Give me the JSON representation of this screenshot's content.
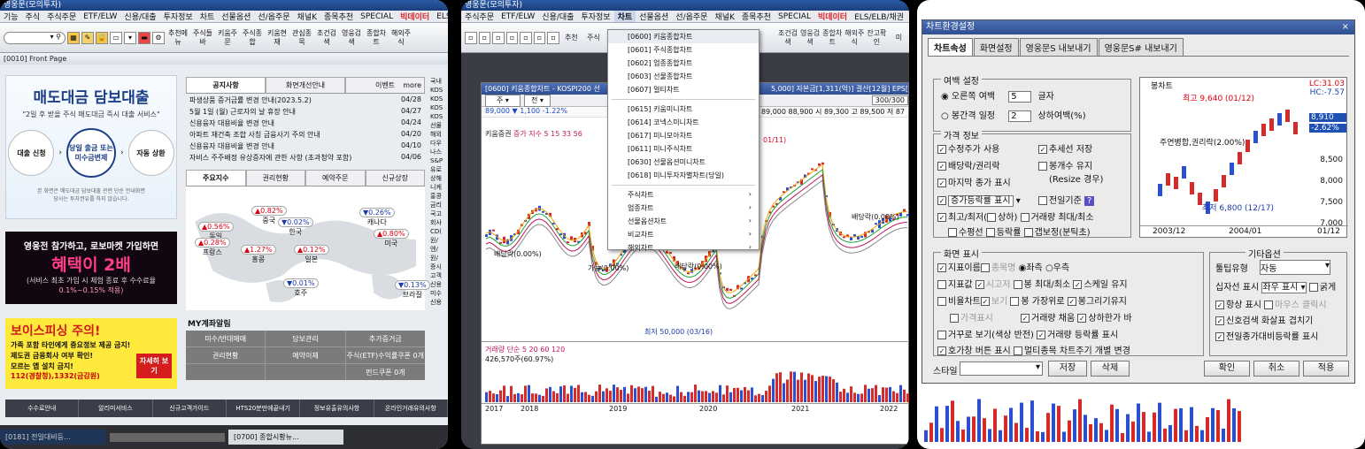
{
  "panel1": {
    "title": "영웅문(모의투자)",
    "menu": [
      "기능",
      "주식",
      "주식주문",
      "ETF/ELW",
      "신용/대출",
      "투자정보",
      "차트",
      "선물옵션",
      "선/옵주문",
      "채널K",
      "종목추천",
      "SPECIAL",
      "빅데이터",
      "ELS/DLS"
    ],
    "toolbar_buttons": [
      "추천메뉴",
      "주식들바",
      "키움주문",
      "주식종합",
      "키움현재",
      "관심종목",
      "조건검색",
      "영웅검색",
      "종합차트",
      "해외주식"
    ],
    "window_title": "[0010] Front Page",
    "promo": {
      "title": "매도대금 담보대출",
      "subtitle": "\"2일 후 받을 주식 매도대금 즉시 대출 서비스\"",
      "step1": "대출 신청",
      "step2": "당일 출금 또는 미수금변제",
      "step3": "자동 상환",
      "note1": "본 화면은 매도대금 담보대출 관련 단순 안내화면",
      "note2": "당사는 투자권유를 하지 않습니다."
    },
    "promo2": {
      "line1": "영웅전 참가하고, 로보마켓 가입하면",
      "line2": "혜택이 2배",
      "line3": "(서비스 최초 가입 시 체험 종료 후 수수료율",
      "line4": "0.1%~0.15% 적용)"
    },
    "phishing": {
      "title": "보이스피싱 주의!",
      "items": [
        "가족 포함 타인에게 중요정보 제공 금지!",
        "제도권 금융회사 여부 확인!",
        "모르는 앱 설치 금지!"
      ],
      "contact": "112(경찰청),1332(금감원)",
      "detail": "자세히 보기"
    },
    "notice_tabs": [
      "공지사항",
      "화면개선안내",
      "이벤트"
    ],
    "more": "more",
    "news": [
      {
        "t": "파생상품 증거금률 변경 안내(2023.5.2)",
        "d": "04/28"
      },
      {
        "t": "5월 1일 (월) 근로자의 날 휴장 안내",
        "d": "04/27"
      },
      {
        "t": "신용융자 대용비율 변경 안내",
        "d": "04/24"
      },
      {
        "t": "아파트 재건축 조합 사칭 금융사기 주의 안내",
        "d": "04/20"
      },
      {
        "t": "신용융자 대용비율 변경 안내",
        "d": "04/10"
      },
      {
        "t": "자비스 주주배정 유상증자에 관한 사항 (초과청약 포함)",
        "d": "04/06"
      }
    ],
    "index_tabs": [
      "주요지수",
      "권리현황",
      "예약주문",
      "신규상장"
    ],
    "map": [
      {
        "n": "독일",
        "v": "▲0.56%"
      },
      {
        "n": "중국",
        "v": "▲0.82%"
      },
      {
        "n": "한국",
        "v": "▼0.02%"
      },
      {
        "n": "캐나다",
        "v": "▼0.26%"
      },
      {
        "n": "프랑스",
        "v": "▲0.28%"
      },
      {
        "n": "홍콩",
        "v": "▲1.27%"
      },
      {
        "n": "일본",
        "v": "▲0.12%"
      },
      {
        "n": "미국",
        "v": "▲0.80%"
      },
      {
        "n": "호주",
        "v": "▼0.01%"
      },
      {
        "n": "브라질",
        "v": "▼0.13%"
      }
    ],
    "my_title": "MY계좌알림",
    "my_items": [
      "미수/반대매매",
      "담보관리",
      "추가증거금",
      "권리현황",
      "예약이체",
      "주식(ETF)수익률쿠폰 0개",
      "",
      "",
      "펀드쿠폰 0개"
    ],
    "bottom_nav": [
      "수수료안내",
      "알리미서비스",
      "신규고객가이드",
      "HTS20분만에끝내기",
      "정보유출유의사항",
      "온라인거래유의사항"
    ],
    "taskbar": [
      "[0181] 전일대비등...",
      "[0700] 종합시황뉴..."
    ],
    "side_labels": [
      "국내",
      "KOS",
      "KOS",
      "KOS",
      "KOS",
      "선물",
      "해외",
      "다우",
      "나스",
      "S&P",
      "유로",
      "상해",
      "니케",
      "홍콩",
      "금리",
      "국고",
      "회사",
      "CD(",
      "원/",
      "엔/",
      "원/",
      "증시",
      "고객",
      "신용",
      "미수",
      "신용"
    ]
  },
  "panel2": {
    "title": "영웅문(모의투자)",
    "menu": [
      "주식주문",
      "ETF/ELW",
      "신용/대출",
      "투자정보",
      "차트",
      "선물옵션",
      "선/옵주문",
      "채널K",
      "종목추천",
      "SPECIAL",
      "빅데이터",
      "ELS/ELB/채권",
      "금"
    ],
    "toolbar_left": [
      "추천",
      "주식"
    ],
    "toolbar_right": [
      "조건검색",
      "영웅검색",
      "종합차트",
      "해외주식",
      "잔고확인",
      "미"
    ],
    "window_title": "[0600] 키움종합차트 - KOSPI200 선",
    "window_title_right": "5,000] 자본금[1,311(억)] 결산[12월] EPS[",
    "dropdown": {
      "items": [
        "[0600] 키움종합차트",
        "[0601] 주식종합차트",
        "[0602] 업종종합차트",
        "[0603] 선물종합차트",
        "[0607] 멀티차트"
      ],
      "items2": [
        "[0615] 키움미니차트",
        "[0614] 코넥스미니차트",
        "[0617] 미니모아차트",
        "[0611] 미니주식차트",
        "[0630] 선물옵션미니차트",
        "[0618] 미니투자자별차트(당일)"
      ],
      "submenus": [
        "주식차트",
        "업종차트",
        "선물옵션차트",
        "비교차트",
        "해외차트"
      ]
    },
    "price_row": "89,000  ▼  1,100  -1.22%",
    "price_row_right": "89,000  88,900  시 89,300  고 89,500  저 87",
    "indicator_label": "키움증권",
    "ma_label": "증가 지수 5  15  33  56",
    "paging": "300/300",
    "annotations": {
      "high": "01/11)",
      "right": "배당락(0.00%)",
      "left": "배당락(0.00%)",
      "mid1": "가능(0.00%)",
      "mid2": "배당락(0.00%)",
      "low": "최저 50,000 (03/16)"
    },
    "volume_label": "거래량 단순 5 20 60 120",
    "volume_value": "426,570주(60.97%)",
    "x_labels": [
      "2017",
      "2018",
      "2019",
      "2020",
      "2021",
      "2022"
    ]
  },
  "panel3": {
    "dialog_title": "차트환경설정",
    "tabs": [
      "차트속성",
      "화면설정",
      "영웅문S 내보내기",
      "영웅문S# 내보내기"
    ],
    "margin": {
      "title": "여백 설정",
      "opt1": "오른쪽 여백",
      "val1": "5",
      "unit1": "글자",
      "opt2": "봉간격 일정",
      "val2": "2",
      "unit2": "상하여백(%)"
    },
    "preview": {
      "label": "봉차트",
      "high": "최고 9,640 (01/12)",
      "low": "최저 6,800 (12/17)",
      "note": "주연병합,권리락(2.00%)",
      "lc": "LC:31.03",
      "hc": "HC:-7.57",
      "cur": "8,910",
      "pct": "-2.62%",
      "y": [
        "8,500",
        "8,000",
        "7,500",
        "7,000"
      ],
      "x": [
        "2003/12",
        "2004/01",
        "01/12"
      ]
    },
    "price_info": {
      "title": "가격 정보",
      "items": [
        "수정주가 사용",
        "추세선 저장",
        "배당락/권리락",
        "봉개수 유지",
        "(Resize 경우)",
        "마지막 종가 표시",
        "증가등락률 표시",
        "전일기준",
        "최고/최저(",
        "상하)",
        "거래량 최대/최소",
        "수평선",
        "등락률",
        "갭보정(분틱초)"
      ]
    },
    "screen": {
      "title": "화면 표시",
      "items": [
        "지표이름",
        "종목명",
        "좌측",
        "우측",
        "지표값",
        "시고저",
        "봉 최대/최소",
        "스케일 유지",
        "비율차트",
        "보기",
        "봉 가장위로",
        "봉그리기유지",
        "가격표시",
        "거래량 채움",
        "상하한가 바",
        "거꾸로 보기(색상 반전)",
        "거래량 등락률 표시",
        "호가창 버튼 표시",
        "멀티종목 차트주기 개별 변경"
      ]
    },
    "other": {
      "title": "기타옵션",
      "tooltip_label": "툴팁유형",
      "tooltip_value": "자동",
      "cross_label": "십자선 표시",
      "cross_value": "좌우 표시",
      "bold": "굵게",
      "items": [
        "항상 표시",
        "마우스 클릭시",
        "신호검색 화살표 겹치기",
        "전일종가대비등락률 표시"
      ]
    },
    "style_label": "스타일",
    "save": "저장",
    "delete": "삭제",
    "ok": "확인",
    "cancel": "취소",
    "apply": "적용"
  }
}
